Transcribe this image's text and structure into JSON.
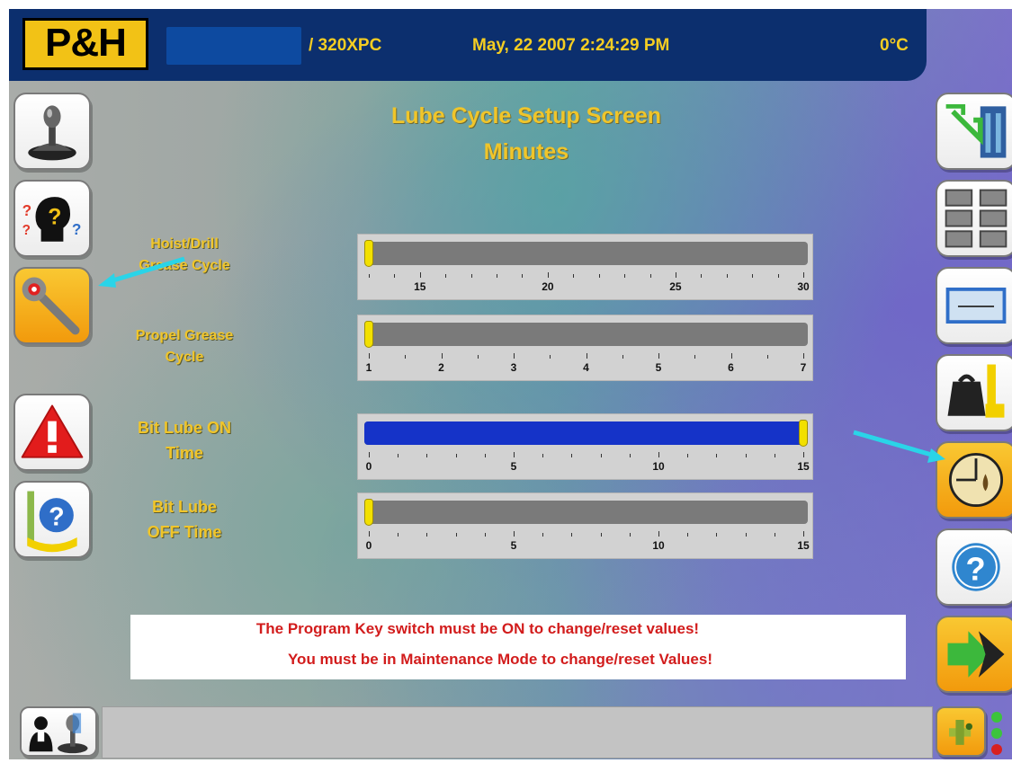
{
  "header": {
    "logo": "P&H",
    "model": "/ 320XPC",
    "datetime": "May, 22 2007 2:24:29 PM",
    "temperature": "0°C"
  },
  "title": {
    "line1": "Lube Cycle Setup Screen",
    "line2": "Minutes"
  },
  "parameters": [
    {
      "label_line1": "Hoist/Drill",
      "label_line2": "Grease Cycle",
      "min": 13,
      "max": 30,
      "value": 13,
      "tick_labels": [
        "15",
        "20",
        "25",
        "30"
      ],
      "tick_values": [
        15,
        20,
        25,
        30
      ],
      "fill_color": "#7a7a7a"
    },
    {
      "label_line1": "Propel Grease",
      "label_line2": "Cycle",
      "min": 1,
      "max": 7,
      "value": 1,
      "tick_labels": [
        "1",
        "2",
        "3",
        "4",
        "5",
        "6",
        "7"
      ],
      "tick_values": [
        1,
        2,
        3,
        4,
        5,
        6,
        7
      ],
      "fill_color": "#7a7a7a"
    },
    {
      "label_line1": "Bit Lube ON",
      "label_line2": "Time",
      "min": 0,
      "max": 15,
      "value": 15,
      "tick_labels": [
        "0",
        "5",
        "10",
        "15"
      ],
      "tick_values": [
        0,
        5,
        10,
        15
      ],
      "fill_color": "#1533c8"
    },
    {
      "label_line1": "Bit Lube",
      "label_line2": "OFF Time",
      "min": 0,
      "max": 15,
      "value": 0,
      "tick_labels": [
        "0",
        "5",
        "10",
        "15"
      ],
      "tick_values": [
        0,
        5,
        10,
        15
      ],
      "fill_color": "#7a7a7a"
    }
  ],
  "messages": {
    "line1": "The Program Key switch must be ON to change/reset values!",
    "line2": "You must be in Maintenance Mode to change/reset Values!"
  },
  "left_nav": [
    {
      "name": "joystick-icon",
      "active": false
    },
    {
      "name": "help-person-icon",
      "active": false
    },
    {
      "name": "wrench-icon",
      "active": true
    },
    {
      "name": "alarm-warning-icon",
      "active": false
    },
    {
      "name": "drill-help-icon",
      "active": false
    }
  ],
  "right_nav": [
    {
      "name": "machine-view-icon",
      "active": false
    },
    {
      "name": "grid-layout-icon",
      "active": false
    },
    {
      "name": "display-panel-icon",
      "active": false
    },
    {
      "name": "weight-ruler-icon",
      "active": false
    },
    {
      "name": "lube-gauge-icon",
      "active": true
    },
    {
      "name": "help-icon",
      "active": false
    },
    {
      "name": "next-arrow-icon",
      "active": false
    }
  ],
  "colors": {
    "header_bg": "#0c2f6e",
    "accent_yellow": "#f0c52a",
    "message_red": "#d21c1c",
    "active_button": "#f29a0c",
    "pointer_arrow": "#2ad4e8"
  }
}
